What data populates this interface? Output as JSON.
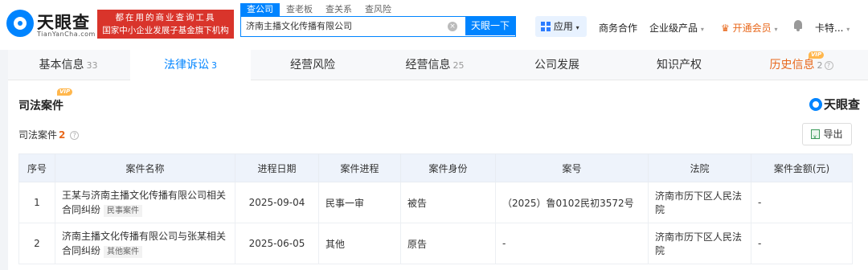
{
  "header": {
    "logo_text": "天眼查",
    "logo_sub": "TianYanCha.com",
    "slogan_line1": "都在用的商业查询工具",
    "slogan_line2": "国家中小企业发展子基金旗下机构",
    "search_tabs": [
      "查公司",
      "查老板",
      "查关系",
      "查风险"
    ],
    "search_value": "济南主播文化传播有限公司",
    "search_button": "天眼一下",
    "app_button": "应用",
    "nav": {
      "business": "商务合作",
      "enterprise": "企业级产品",
      "vip": "开通会员",
      "user": "卡特..."
    }
  },
  "tabs": [
    {
      "label": "基本信息",
      "count": "33"
    },
    {
      "label": "法律诉讼",
      "count": "3"
    },
    {
      "label": "经营风险",
      "count": ""
    },
    {
      "label": "经营信息",
      "count": "25"
    },
    {
      "label": "公司发展",
      "count": ""
    },
    {
      "label": "知识产权",
      "count": ""
    },
    {
      "label": "历史信息",
      "count": "2"
    }
  ],
  "vip_tag": "VIP",
  "section": {
    "title": "司法案件",
    "brand": "天眼查",
    "subtitle": "司法案件",
    "count": "2",
    "export_label": "导出"
  },
  "table": {
    "headers": [
      "序号",
      "案件名称",
      "进程日期",
      "案件进程",
      "案件身份",
      "案号",
      "法院",
      "案件金额(元)"
    ],
    "rows": [
      {
        "index": "1",
        "name": "王某与济南主播文化传播有限公司相关合同纠纷",
        "tag": "民事案件",
        "date": "2025-09-04",
        "stage": "民事一审",
        "role": "被告",
        "case_no": "（2025）鲁0102民初3572号",
        "court": "济南市历下区人民法院",
        "amount": "-"
      },
      {
        "index": "2",
        "name": "济南主播文化传播有限公司与张某相关合同纠纷",
        "tag": "其他案件",
        "date": "2025-06-05",
        "stage": "其他",
        "role": "原告",
        "case_no": "-",
        "court": "济南市历下区人民法院",
        "amount": "-"
      }
    ]
  },
  "colors": {
    "brand_blue": "#0084ff",
    "slogan_red": "#d9342b",
    "accent_orange": "#e8681c"
  }
}
